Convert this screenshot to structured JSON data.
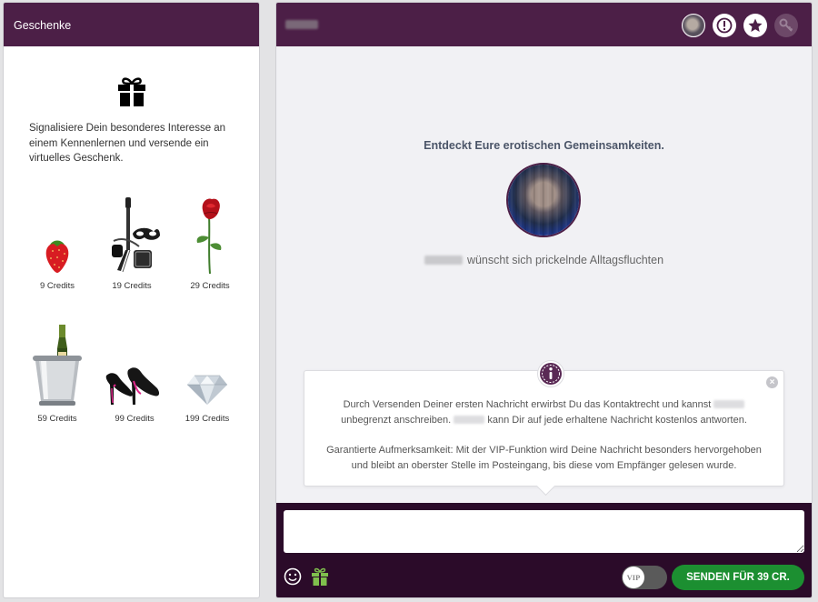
{
  "left_panel": {
    "title": "Geschenke",
    "description": "Signalisiere Dein besonderes Interesse an einem Kennenlernen und versende ein virtuelles Geschenk.",
    "gifts": [
      {
        "name": "strawberry",
        "price": "9 Credits"
      },
      {
        "name": "bdsm-set",
        "price": "19 Credits"
      },
      {
        "name": "rose",
        "price": "29 Credits"
      },
      {
        "name": "champagne",
        "price": "59 Credits"
      },
      {
        "name": "high-heels",
        "price": "99 Credits"
      },
      {
        "name": "diamond",
        "price": "199 Credits"
      }
    ]
  },
  "chat": {
    "header_icons": [
      "avatar",
      "info-icon",
      "star-icon",
      "key-icon"
    ],
    "match_title": "Entdeckt Eure erotischen Gemeinsamkeiten.",
    "match_text": "wünscht sich prickelnde Alltagsfluchten",
    "info": {
      "line1a": "Durch Versenden Deiner ersten Nachricht erwirbst Du das Kontaktrecht und kannst",
      "line1b": "unbegrenzt anschreiben.",
      "line1c": "kann Dir auf jede erhaltene Nachricht kostenlos antworten.",
      "line2": "Garantierte Aufmerksamkeit: Mit der VIP-Funktion wird Deine Nachricht besonders hervorgehoben und bleibt an oberster Stelle im Posteingang, bis diese vom Empfänger gelesen wurde."
    },
    "message_value": "",
    "vip_label": "VIP",
    "send_label": "SENDEN FÜR 39 CR.",
    "colors": {
      "header": "#4c1f47",
      "compose": "#2b0b29",
      "send": "#1c8f31"
    }
  }
}
